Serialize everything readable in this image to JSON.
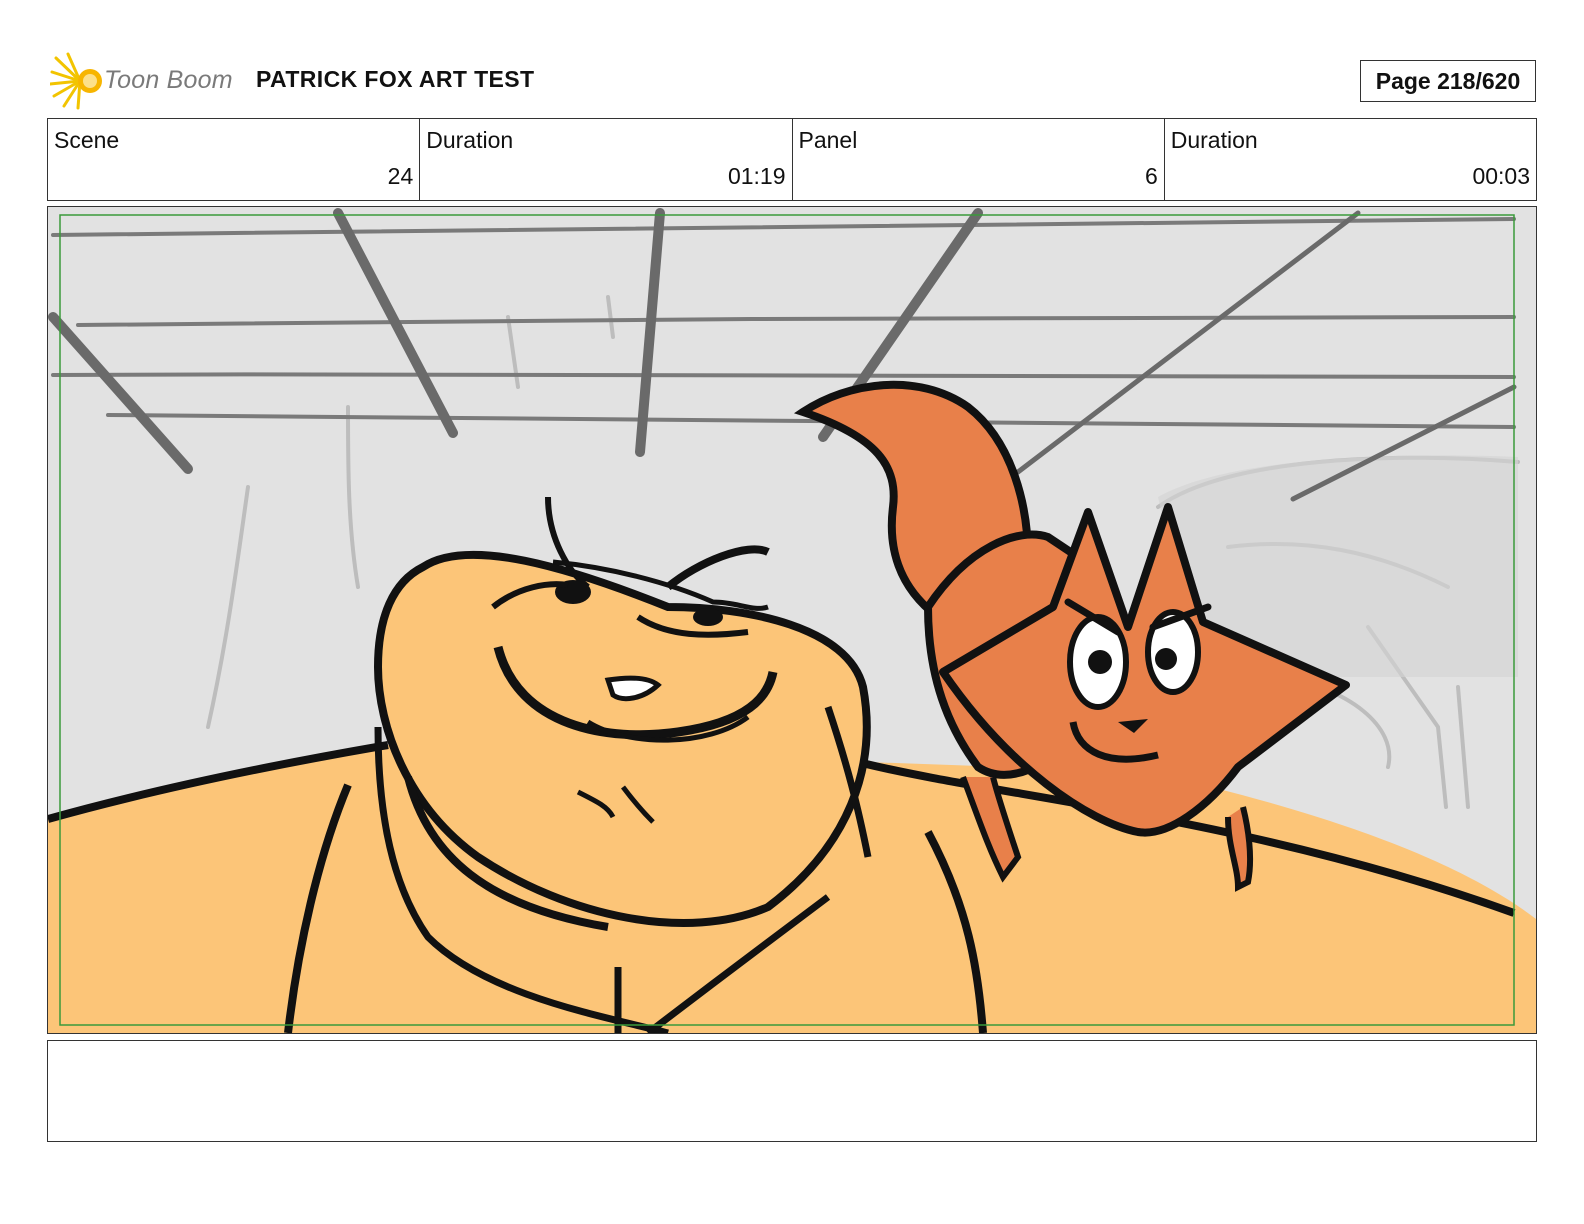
{
  "header": {
    "logo_text": "Toon Boom",
    "project_title": "PATRICK FOX ART TEST",
    "page_label": "Page 218/620"
  },
  "info": [
    {
      "label": "Scene",
      "value": "24"
    },
    {
      "label": "Duration",
      "value": "01:19"
    },
    {
      "label": "Panel",
      "value": "6"
    },
    {
      "label": "Duration",
      "value": "00:03"
    }
  ],
  "panel": {
    "description": "",
    "colors": {
      "background": "#e2e2e2",
      "floor": "#fcc578",
      "fox": "#e8804a",
      "outline": "#111111",
      "safe_frame": "#3a9a3a"
    }
  },
  "notes": {
    "text": ""
  }
}
